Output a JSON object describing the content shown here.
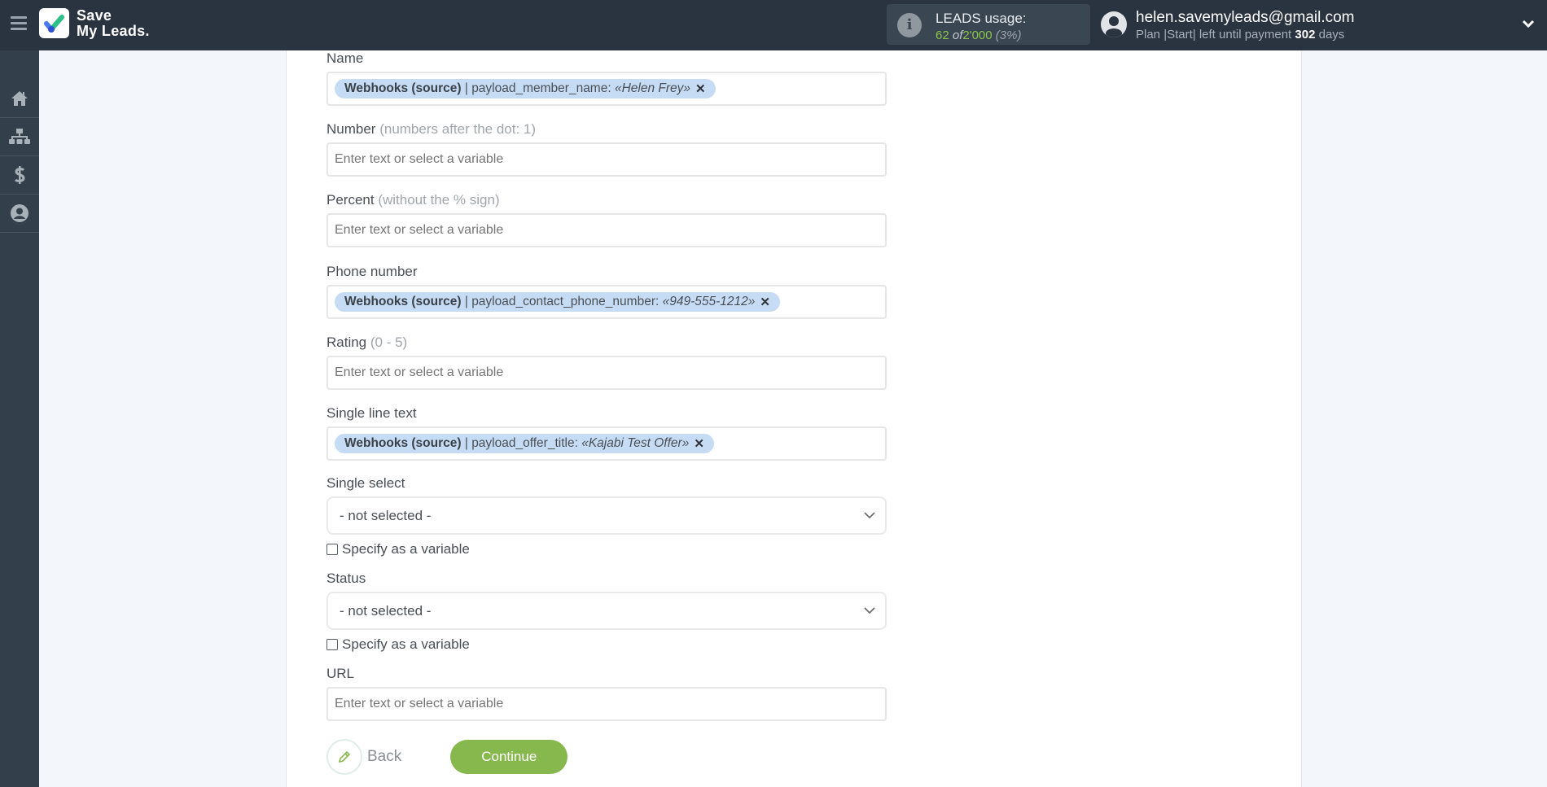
{
  "header": {
    "logo_line1": "Save",
    "logo_line2": "My Leads.",
    "usage_title": "LEADS usage:",
    "usage_used": "62",
    "usage_of": "of",
    "usage_total": "2'000",
    "usage_percent": "(3%)",
    "user_email": "helen.savemyleads@gmail.com",
    "plan_prefix": "Plan |Start| left until payment",
    "plan_days": "302",
    "plan_suffix": "days"
  },
  "sidebar": {
    "items": [
      {
        "name": "home",
        "icon": "home-icon"
      },
      {
        "name": "connections",
        "icon": "sitemap-icon"
      },
      {
        "name": "billing",
        "icon": "dollar-icon"
      },
      {
        "name": "account",
        "icon": "user-circle-icon"
      }
    ]
  },
  "form": {
    "placeholder": "Enter text or select a variable",
    "fields": {
      "name": {
        "label": "Name",
        "tag_source": "Webhooks (source)",
        "tag_sep": " | ",
        "tag_field": "payload_member_name: ",
        "tag_value": "«Helen Frey»"
      },
      "number": {
        "label": "Number",
        "hint": "(numbers after the dot: 1)"
      },
      "percent": {
        "label": "Percent",
        "hint": "(without the % sign)"
      },
      "phone": {
        "label": "Phone number",
        "tag_source": "Webhooks (source)",
        "tag_sep": " | ",
        "tag_field": "payload_contact_phone_number: ",
        "tag_value": "«949-555-1212»"
      },
      "rating": {
        "label": "Rating",
        "hint": "(0 - 5)"
      },
      "single_line": {
        "label": "Single line text",
        "tag_source": "Webhooks (source)",
        "tag_sep": " | ",
        "tag_field": "payload_offer_title: ",
        "tag_value": "«Kajabi Test Offer»"
      },
      "single_select": {
        "label": "Single select",
        "value": "- not selected -",
        "checkbox_label": "Specify as a variable",
        "checked": false
      },
      "status": {
        "label": "Status",
        "value": "- not selected -",
        "checkbox_label": "Specify as a variable",
        "checked": false
      },
      "url": {
        "label": "URL"
      }
    },
    "remove_glyph": "✕"
  },
  "actions": {
    "back_label": "Back",
    "continue_label": "Continue"
  },
  "colors": {
    "header_bg": "#2a3441",
    "sidebar_bg": "#343f4c",
    "accent_green": "#86b84e",
    "tag_bg": "#c6dcf5"
  }
}
